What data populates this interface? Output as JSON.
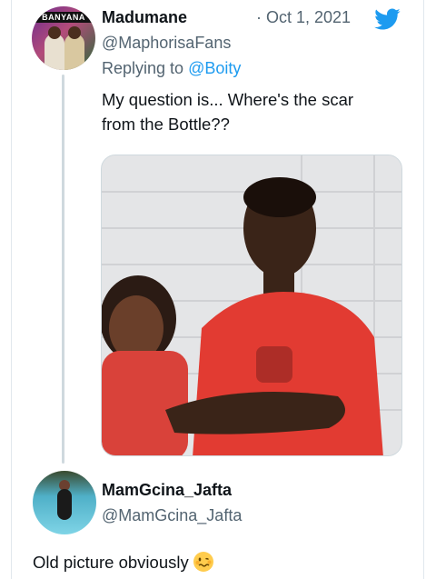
{
  "tweet1": {
    "name": "Madumane",
    "handle": "@MaphorisaFans",
    "date": "· Oct 1, 2021",
    "replying_prefix": "Replying to ",
    "replying_to": "@Boity",
    "text_line1": "My question is... Where's the scar",
    "text_line2": "from the Bottle??",
    "avatar_banner": "BANYANA",
    "media_icon": "photo-two-people-smiling"
  },
  "tweet2": {
    "name": "MamGcina_Jafta",
    "handle": "@MamGcina_Jafta",
    "text": "Old picture obviously",
    "emoji": "woozy-face"
  },
  "brand_icon": "twitter-bird-icon",
  "colors": {
    "brand_blue": "#1d9bf0",
    "secondary_text": "#536471",
    "thread_line": "#cfd9de"
  }
}
